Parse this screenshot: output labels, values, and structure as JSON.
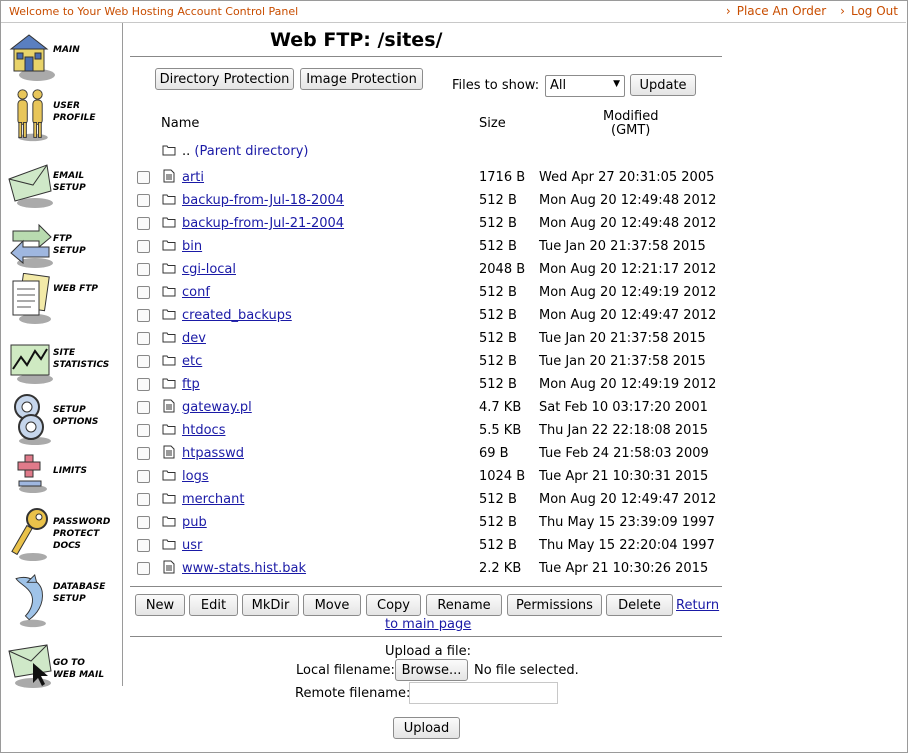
{
  "header": {
    "welcome": "Welcome to Your Web Hosting Account Control Panel",
    "place_order": "Place An Order",
    "log_out": "Log Out"
  },
  "sidebar": {
    "items": [
      {
        "label": "MAIN",
        "icon": "house-icon"
      },
      {
        "label": "USER\nPROFILE",
        "icon": "users-icon"
      },
      {
        "label": "EMAIL\nSETUP",
        "icon": "envelope-icon"
      },
      {
        "label": "FTP\nSETUP",
        "icon": "transfer-arrows-icon"
      },
      {
        "label": "WEB FTP",
        "icon": "documents-icon"
      },
      {
        "label": "SITE\nSTATISTICS",
        "icon": "chart-icon"
      },
      {
        "label": "SETUP\nOPTIONS",
        "icon": "gears-icon"
      },
      {
        "label": "LIMITS",
        "icon": "plus-minus-icon"
      },
      {
        "label": "PASSWORD\nPROTECT\nDOCS",
        "icon": "key-icon"
      },
      {
        "label": "DATABASE\nSETUP",
        "icon": "dolphin-icon"
      },
      {
        "label": "GO TO\nWEB MAIL",
        "icon": "mail-cursor-icon"
      }
    ]
  },
  "page": {
    "title": "Web FTP: /sites/",
    "directory_protection": "Directory Protection",
    "image_protection": "Image Protection",
    "files_to_show_label": "Files to show:",
    "files_to_show_value": "All",
    "update": "Update",
    "col_name": "Name",
    "col_size": "Size",
    "col_modified": "Modified",
    "col_modified_tz": "(GMT)",
    "parent_dots": "..",
    "parent_label": "(Parent directory)"
  },
  "files": [
    {
      "name": "arti",
      "type": "file",
      "size": "1716 B",
      "modified": "Wed Apr 27 20:31:05 2005"
    },
    {
      "name": "backup-from-Jul-18-2004",
      "type": "folder",
      "size": "512 B",
      "modified": "Mon Aug 20 12:49:48 2012"
    },
    {
      "name": "backup-from-Jul-21-2004",
      "type": "folder",
      "size": "512 B",
      "modified": "Mon Aug 20 12:49:48 2012"
    },
    {
      "name": "bin",
      "type": "folder",
      "size": "512 B",
      "modified": "Tue Jan 20 21:37:58 2015"
    },
    {
      "name": "cgi-local",
      "type": "folder",
      "size": "2048 B",
      "modified": "Mon Aug 20 12:21:17 2012"
    },
    {
      "name": "conf",
      "type": "folder",
      "size": "512 B",
      "modified": "Mon Aug 20 12:49:19 2012"
    },
    {
      "name": "created_backups",
      "type": "folder",
      "size": "512 B",
      "modified": "Mon Aug 20 12:49:47 2012"
    },
    {
      "name": "dev",
      "type": "folder",
      "size": "512 B",
      "modified": "Tue Jan 20 21:37:58 2015"
    },
    {
      "name": "etc",
      "type": "folder",
      "size": "512 B",
      "modified": "Tue Jan 20 21:37:58 2015"
    },
    {
      "name": "ftp",
      "type": "folder",
      "size": "512 B",
      "modified": "Mon Aug 20 12:49:19 2012"
    },
    {
      "name": "gateway.pl",
      "type": "file",
      "size": "4.7 KB",
      "modified": "Sat Feb 10 03:17:20 2001"
    },
    {
      "name": "htdocs",
      "type": "folder",
      "size": "5.5 KB",
      "modified": "Thu Jan 22 22:18:08 2015"
    },
    {
      "name": "htpasswd",
      "type": "file",
      "size": "69 B",
      "modified": "Tue Feb 24 21:58:03 2009"
    },
    {
      "name": "logs",
      "type": "folder",
      "size": "1024 B",
      "modified": "Tue Apr 21 10:30:31 2015"
    },
    {
      "name": "merchant",
      "type": "folder",
      "size": "512 B",
      "modified": "Mon Aug 20 12:49:47 2012"
    },
    {
      "name": "pub",
      "type": "folder",
      "size": "512 B",
      "modified": "Thu May 15 23:39:09 1997"
    },
    {
      "name": "usr",
      "type": "folder",
      "size": "512 B",
      "modified": "Thu May 15 22:20:04 1997"
    },
    {
      "name": "www-stats.hist.bak",
      "type": "file",
      "size": "2.2 KB",
      "modified": "Tue Apr 21 10:30:26 2015"
    }
  ],
  "actions": {
    "new": "New",
    "edit": "Edit",
    "mkdir": "MkDir",
    "move": "Move",
    "copy": "Copy",
    "rename": "Rename",
    "permissions": "Permissions",
    "delete": "Delete",
    "return_1": "Return",
    "return_2": "to main page"
  },
  "upload": {
    "heading": "Upload a file:",
    "local_label": "Local filename:",
    "browse": "Browse...",
    "no_file": "No file selected.",
    "remote_label": "Remote filename:",
    "remote_value": "",
    "upload": "Upload"
  },
  "colors": {
    "header_text": "#c84d00",
    "link": "#1a1aa6"
  }
}
